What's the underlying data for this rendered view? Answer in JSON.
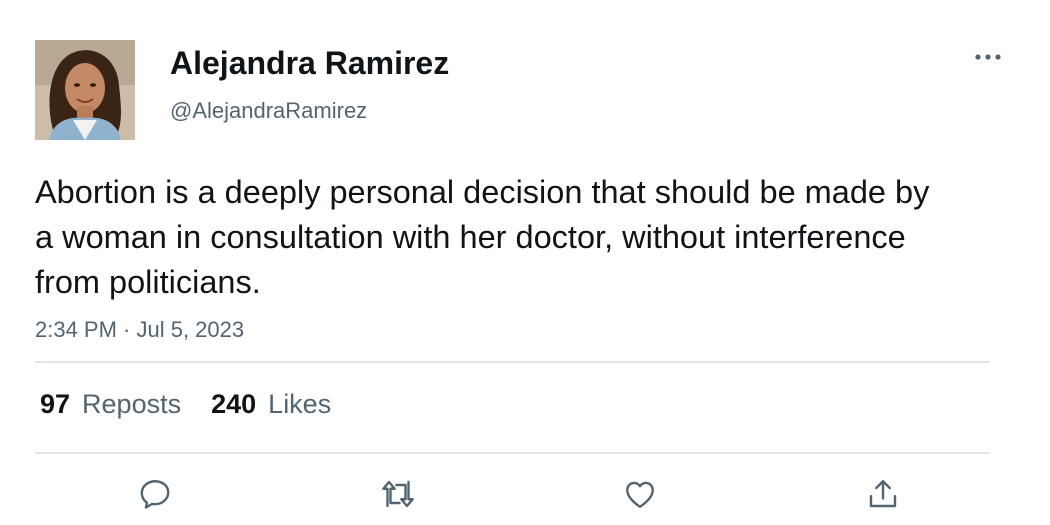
{
  "author": {
    "display_name": "Alejandra Ramirez",
    "handle": "@AlejandraRamirez",
    "avatar_icon": "profile-photo"
  },
  "tweet": {
    "text": "Abortion is a deeply personal decision that should be made by a woman in consultation with her doctor, without interference from politicians.",
    "timestamp": "2:34 PM · Jul 5, 2023"
  },
  "stats": {
    "reposts_count": "97",
    "reposts_label": "Reposts",
    "likes_count": "240",
    "likes_label": "Likes"
  },
  "actions": [
    {
      "icon": "reply-icon"
    },
    {
      "icon": "repost-icon"
    },
    {
      "icon": "like-icon"
    },
    {
      "icon": "share-icon"
    }
  ],
  "colors": {
    "text_primary": "#0f1419",
    "text_secondary": "#536471",
    "divider": "#e1e6ea",
    "icon": "#536471"
  }
}
